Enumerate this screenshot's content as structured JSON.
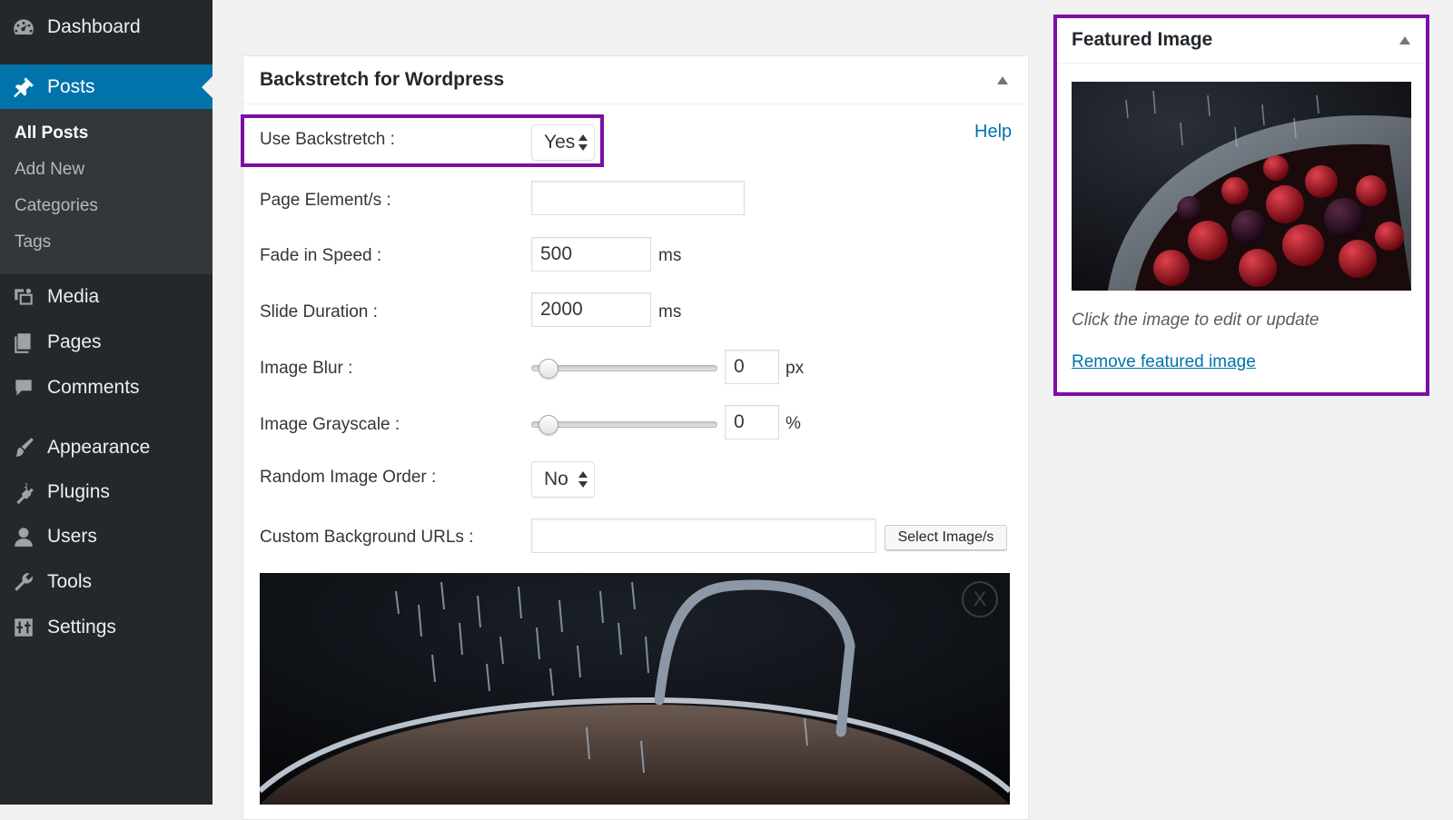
{
  "sidebar": {
    "items": [
      {
        "label": "Dashboard",
        "icon": "dashboard-icon"
      },
      {
        "label": "Posts",
        "icon": "pin-icon",
        "current": true
      },
      {
        "label": "Media",
        "icon": "media-icon"
      },
      {
        "label": "Pages",
        "icon": "pages-icon"
      },
      {
        "label": "Comments",
        "icon": "comment-icon"
      },
      {
        "label": "Appearance",
        "icon": "paintbrush-icon"
      },
      {
        "label": "Plugins",
        "icon": "plugin-icon"
      },
      {
        "label": "Users",
        "icon": "user-icon"
      },
      {
        "label": "Tools",
        "icon": "wrench-icon"
      },
      {
        "label": "Settings",
        "icon": "settings-icon"
      }
    ],
    "submenu": [
      "All Posts",
      "Add New",
      "Categories",
      "Tags"
    ]
  },
  "metabox": {
    "title": "Backstretch for Wordpress",
    "help": "Help",
    "fields": {
      "use_backstretch": {
        "label": "Use Backstretch :",
        "value": "Yes"
      },
      "page_elements": {
        "label": "Page Element/s :",
        "value": ""
      },
      "fade_in_speed": {
        "label": "Fade in Speed :",
        "value": "500",
        "unit": "ms"
      },
      "slide_duration": {
        "label": "Slide Duration :",
        "value": "2000",
        "unit": "ms"
      },
      "image_blur": {
        "label": "Image Blur :",
        "value": "0",
        "unit": "px",
        "slider_fraction": 0
      },
      "image_grayscale": {
        "label": "Image Grayscale :",
        "value": "0",
        "unit": "%",
        "slider_fraction": 0
      },
      "random_order": {
        "label": "Random Image Order :",
        "value": "No"
      },
      "custom_urls": {
        "label": "Custom Background URLs :",
        "value": "",
        "button": "Select Image/s"
      }
    },
    "preview_close": "X"
  },
  "featured": {
    "title": "Featured Image",
    "caption": "Click the image to edit or update",
    "remove": "Remove featured image"
  },
  "colors": {
    "sidebar_bg": "#23282d",
    "accent": "#0073aa",
    "highlight": "#7b0fa3"
  }
}
